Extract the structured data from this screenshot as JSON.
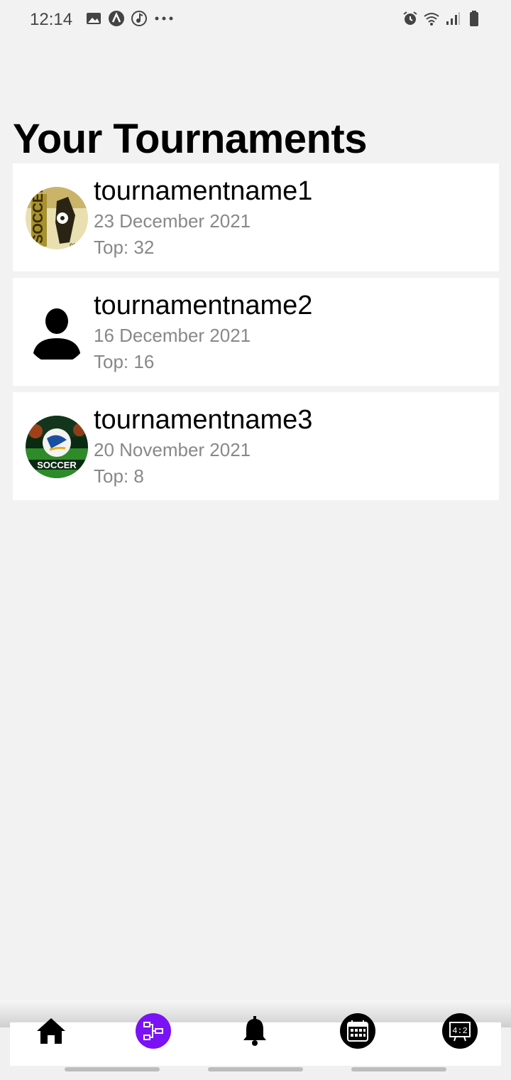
{
  "status_bar": {
    "time": "12:14",
    "left_icons": [
      "image-icon",
      "a-circle-icon",
      "music-circle-icon",
      "more-dots-icon"
    ],
    "right_icons": [
      "alarm-icon",
      "wifi-icon",
      "signal-icon",
      "battery-icon"
    ]
  },
  "page": {
    "title": "Your Tournaments"
  },
  "tournaments": [
    {
      "name": "tournamentname1",
      "date": "23 December 2021",
      "top": "Top: 32",
      "avatar": "soccer-poster-avatar"
    },
    {
      "name": "tournamentname2",
      "date": "16 December 2021",
      "top": "Top: 16",
      "avatar": "person-placeholder-avatar"
    },
    {
      "name": "tournamentname3",
      "date": "20 November 2021",
      "top": "Top: 8",
      "avatar": "soccer-ball-avatar"
    }
  ],
  "bottom_nav": {
    "items": [
      "home-icon",
      "bracket-icon",
      "bell-icon",
      "calendar-icon",
      "scoreboard-icon"
    ],
    "active": "bracket-icon",
    "accent": "#7a12f5"
  }
}
